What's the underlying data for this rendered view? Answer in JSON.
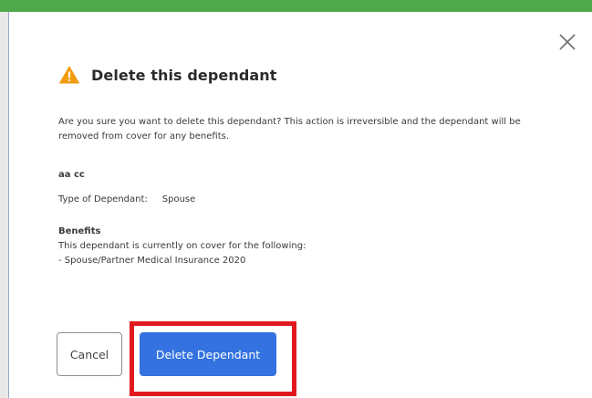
{
  "modal": {
    "title": "Delete this dependant",
    "warning_icon": "warning-triangle-icon",
    "close_icon": "close-icon",
    "message": "Are you sure you want to delete this dependant? This action is irreversible and the dependant will be removed from cover for any benefits.",
    "dependant": {
      "name": "aa cc",
      "type_label": "Type of Dependant:",
      "type_value": "Spouse"
    },
    "benefits": {
      "heading": "Benefits",
      "intro": "This dependant is currently on cover for the following:",
      "items": [
        "- Spouse/Partner Medical Insurance 2020"
      ]
    },
    "buttons": {
      "cancel_label": "Cancel",
      "delete_label": "Delete Dependant"
    }
  },
  "colors": {
    "top_bar": "#4fa84a",
    "primary_button": "#3372e0",
    "warning": "#f39c12",
    "highlight": "#e21a1f"
  }
}
